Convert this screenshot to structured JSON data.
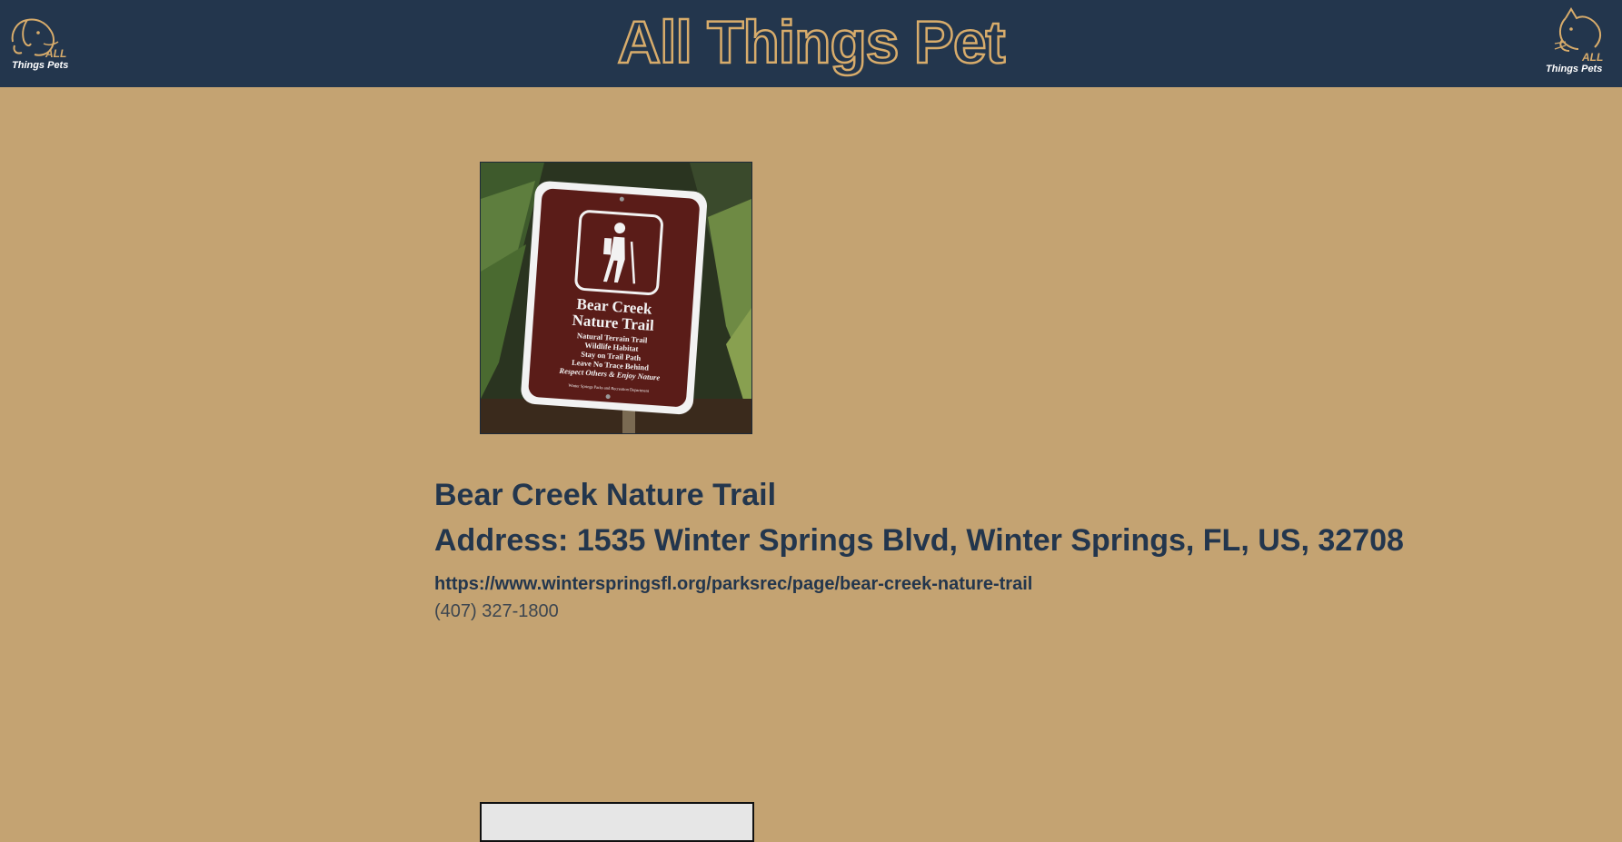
{
  "header": {
    "title": "All Things Pet",
    "logo_left": {
      "all_text": "ALL",
      "things_text": "Things Pets",
      "icon": "dog-logo-icon"
    },
    "logo_right": {
      "all_text": "ALL",
      "things_text": "Things Pets",
      "icon": "cat-logo-icon"
    }
  },
  "listing": {
    "image": {
      "icon": "trail-sign-image",
      "sign_title_line1": "Bear Creek",
      "sign_title_line2": "Nature Trail",
      "sign_line1": "Natural Terrain Trail",
      "sign_line2": "Wildlife Habitat",
      "sign_line3": "Stay on Trail Path",
      "sign_line4": "Leave No Trace Behind",
      "sign_line5": "Respect Others & Enjoy Nature",
      "sign_footer": "Winter Springs Parks and Recreation Department"
    },
    "name": "Bear Creek Nature Trail",
    "address": "Address: 1535 Winter Springs Blvd, Winter Springs, FL, US, 32708",
    "website": "https://www.winterspringsfl.org/parksrec/page/bear-creek-nature-trail",
    "phone": "(407) 327-1800"
  },
  "colors": {
    "header_bg": "#23364d",
    "page_bg": "#c4a372",
    "accent": "#d8ac6b",
    "text": "#23364d"
  }
}
